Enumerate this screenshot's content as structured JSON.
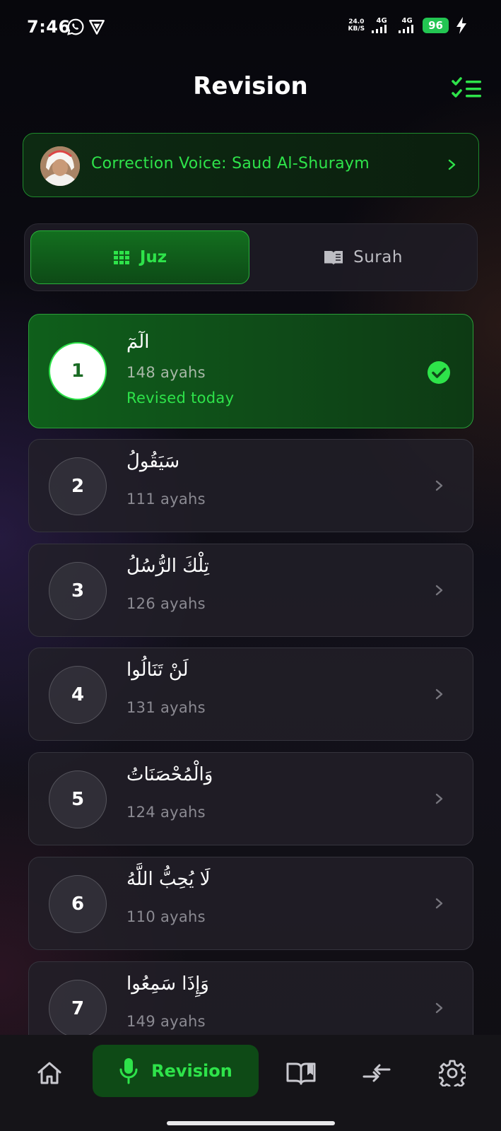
{
  "status_bar": {
    "time": "7:46",
    "net_speed_value": "24.0",
    "net_speed_unit": "KB/S",
    "signal1": "4G",
    "signal2": "4G",
    "battery": "96"
  },
  "header": {
    "title": "Revision"
  },
  "voice": {
    "label": "Correction Voice: Saud Al-Shuraym"
  },
  "tabs": [
    {
      "label": "Juz",
      "selected": true
    },
    {
      "label": "Surah",
      "selected": false
    }
  ],
  "juz_list": [
    {
      "number": "1",
      "name": "الٓمٓ",
      "ayahs": "148 ayahs",
      "status": "Revised today",
      "revised": true
    },
    {
      "number": "2",
      "name": "سَيَقُولُ",
      "ayahs": "111 ayahs",
      "status": "",
      "revised": false
    },
    {
      "number": "3",
      "name": "تِلْكَ الرُّسُلُ",
      "ayahs": "126 ayahs",
      "status": "",
      "revised": false
    },
    {
      "number": "4",
      "name": "لَنْ تَنَالُوا",
      "ayahs": "131 ayahs",
      "status": "",
      "revised": false
    },
    {
      "number": "5",
      "name": "وَالْمُحْصَنَاتُ",
      "ayahs": "124 ayahs",
      "status": "",
      "revised": false
    },
    {
      "number": "6",
      "name": "لَا يُحِبُّ اللَّهُ",
      "ayahs": "110 ayahs",
      "status": "",
      "revised": false
    },
    {
      "number": "7",
      "name": "وَإِذَا سَمِعُوا",
      "ayahs": "149 ayahs",
      "status": "",
      "revised": false
    }
  ],
  "bottom_nav": {
    "active_label": "Revision",
    "icons": [
      "home-icon",
      "microphone-icon",
      "book-open-icon",
      "compare-arrows-icon",
      "settings-gear-icon"
    ]
  },
  "colors": {
    "accent": "#2ee34a",
    "active_card": "#0f5f1b",
    "background": "#0d0c14"
  }
}
